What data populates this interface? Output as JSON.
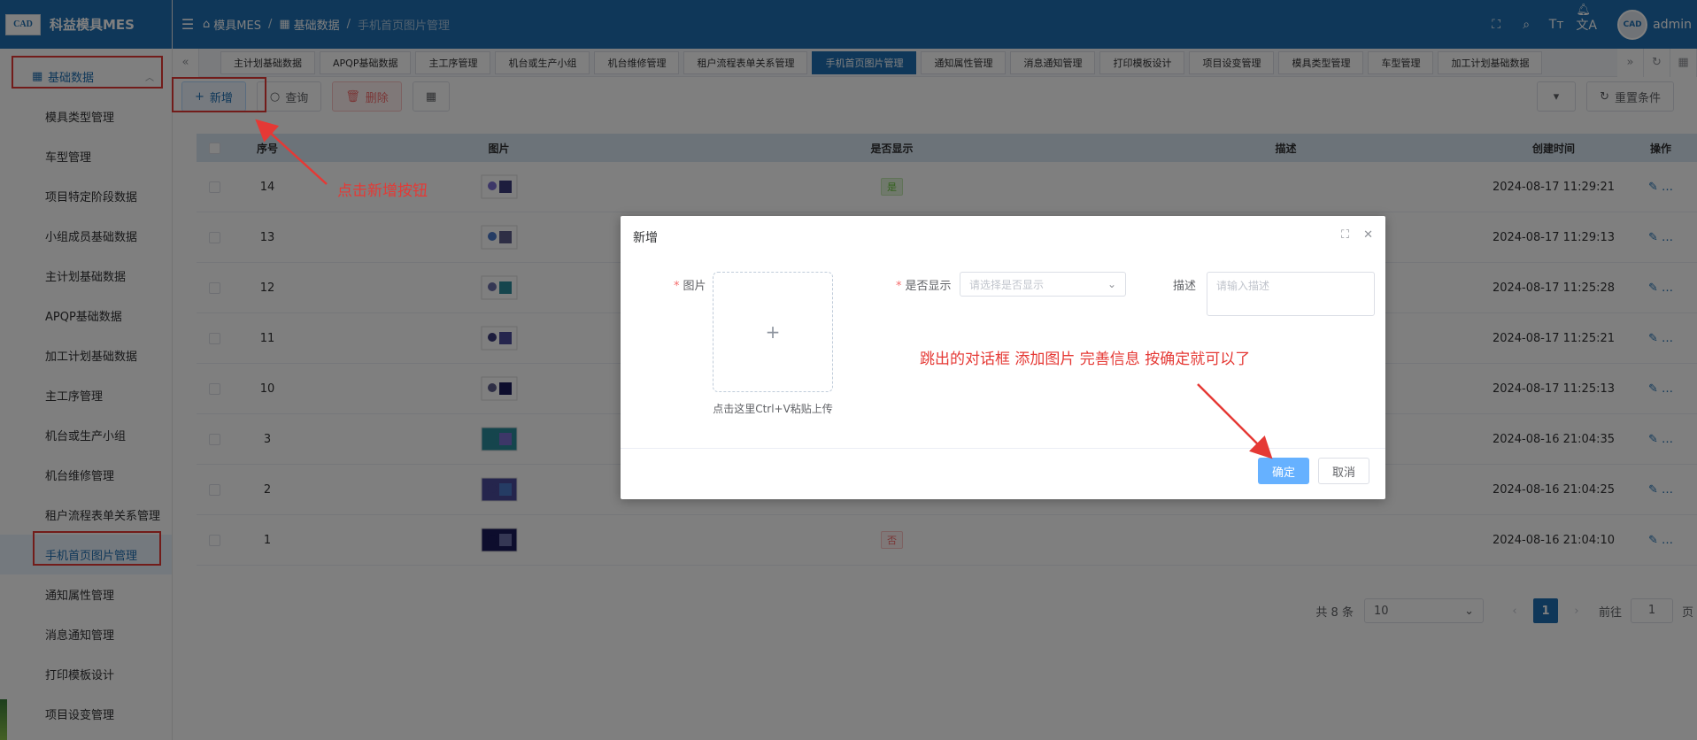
{
  "app": {
    "logo_text": "CAD",
    "title": "科益模具MES"
  },
  "header": {
    "crumbs": [
      "模具MES",
      "基础数据",
      "手机首页图片管理"
    ],
    "user": "admin",
    "avatar_text": "CAD"
  },
  "sidebar": {
    "group": "基础数据",
    "items": [
      "模具类型管理",
      "车型管理",
      "项目特定阶段数据",
      "小组成员基础数据",
      "主计划基础数据",
      "APQP基础数据",
      "加工计划基础数据",
      "主工序管理",
      "机台或生产小组",
      "机台维修管理",
      "租户流程表单关系管理",
      "手机首页图片管理",
      "通知属性管理",
      "消息通知管理",
      "打印模板设计",
      "项目设变管理"
    ],
    "active_index": 11
  },
  "tabs": [
    "主计划基础数据",
    "APQP基础数据",
    "主工序管理",
    "机台或生产小组",
    "机台维修管理",
    "租户流程表单关系管理",
    "手机首页图片管理",
    "通知属性管理",
    "消息通知管理",
    "打印模板设计",
    "项目设变管理",
    "模具类型管理",
    "车型管理",
    "加工计划基础数据"
  ],
  "active_tab": 6,
  "toolbar": {
    "add": "新增",
    "query": "查询",
    "delete": "删除",
    "reset": "重置条件"
  },
  "table": {
    "headers": [
      "序号",
      "图片",
      "是否显示",
      "描述",
      "创建时间",
      "操作"
    ],
    "rows": [
      {
        "no": "14",
        "show": "是",
        "time": "2024-08-17 11:29:21"
      },
      {
        "no": "13",
        "show": "",
        "time": "2024-08-17 11:29:13"
      },
      {
        "no": "12",
        "show": "",
        "time": "2024-08-17 11:25:28"
      },
      {
        "no": "11",
        "show": "",
        "time": "2024-08-17 11:25:21"
      },
      {
        "no": "10",
        "show": "",
        "time": "2024-08-17 11:25:13"
      },
      {
        "no": "3",
        "show": "",
        "time": "2024-08-16 21:04:35"
      },
      {
        "no": "2",
        "show": "",
        "time": "2024-08-16 21:04:25"
      },
      {
        "no": "1",
        "show": "否",
        "time": "2024-08-16 21:04:10"
      }
    ]
  },
  "pager": {
    "total": "共 8 条",
    "size": "10",
    "page": "1",
    "goto": "前往",
    "goto_value": "1",
    "page_unit": "页"
  },
  "dialog": {
    "title": "新增",
    "image_label": "图片",
    "upload_tip": "点击这里Ctrl+V粘贴上传",
    "show_label": "是否显示",
    "show_placeholder": "请选择是否显示",
    "desc_label": "描述",
    "desc_placeholder": "请输入描述",
    "ok": "确定",
    "cancel": "取消"
  },
  "annotations": {
    "add_hint": "点击新增按钮",
    "dialog_hint": "跳出的对话框 添加图片 完善信息 按确定就可以了"
  },
  "colors": {
    "primary": "#1e6fb3",
    "annotation": "#e53935"
  }
}
